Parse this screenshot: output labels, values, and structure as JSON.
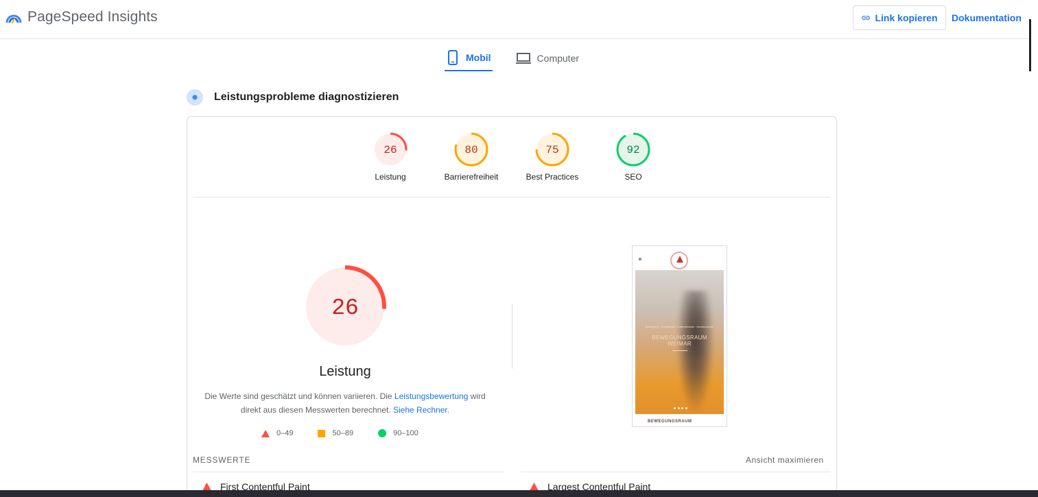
{
  "header": {
    "app_title": "PageSpeed Insights",
    "copy_link_label": "Link kopieren",
    "docs_label": "Dokumentation"
  },
  "tabs": [
    {
      "label": "Mobil",
      "active": true,
      "icon": "smartphone-icon"
    },
    {
      "label": "Computer",
      "active": false,
      "icon": "laptop-icon"
    }
  ],
  "section": {
    "title": "Leistungsprobleme diagnostizieren"
  },
  "scores": [
    {
      "label": "Leistung",
      "value": "26",
      "color": "#ff4e42",
      "bg": "#fdecea"
    },
    {
      "label": "Barrierefreiheit",
      "value": "80",
      "color": "#ffa400",
      "bg": "#fff3e0"
    },
    {
      "label": "Best Practices",
      "value": "75",
      "color": "#ffa400",
      "bg": "#fff3e0"
    },
    {
      "label": "SEO",
      "value": "92",
      "color": "#0cce6b",
      "bg": "#e6f4ea"
    }
  ],
  "main_score": {
    "value": "26",
    "title": "Leistung",
    "desc_part1": "Die Werte sind geschätzt und können variieren. Die ",
    "desc_link1": "Leistungsbewertung",
    "desc_part2": " wird direkt aus diesen Messwerten berechnet. ",
    "desc_link2": "Siehe Rechner",
    "desc_part3": "."
  },
  "legend": [
    {
      "range": "0–49",
      "shape": "triangle",
      "color": "#ff4e42"
    },
    {
      "range": "50–89",
      "shape": "square",
      "color": "#ffa400"
    },
    {
      "range": "90–100",
      "shape": "circle",
      "color": "#0cce6b"
    }
  ],
  "preview": {
    "small_text": "Bewegung · Gesundheit · Lebensfreude · Gemeinschaft",
    "heading_line1": "BEWEGUNGSRAUM",
    "heading_line2": "WEIMAR",
    "bottom_text": "BEWEGUNGSRAUM"
  },
  "metrics": {
    "section_label": "MESSWERTE",
    "maximize_label": "Ansicht maximieren",
    "items": [
      {
        "label": "First Contentful Paint",
        "status": "poor"
      },
      {
        "label": "Largest Contentful Paint",
        "status": "poor"
      }
    ]
  }
}
